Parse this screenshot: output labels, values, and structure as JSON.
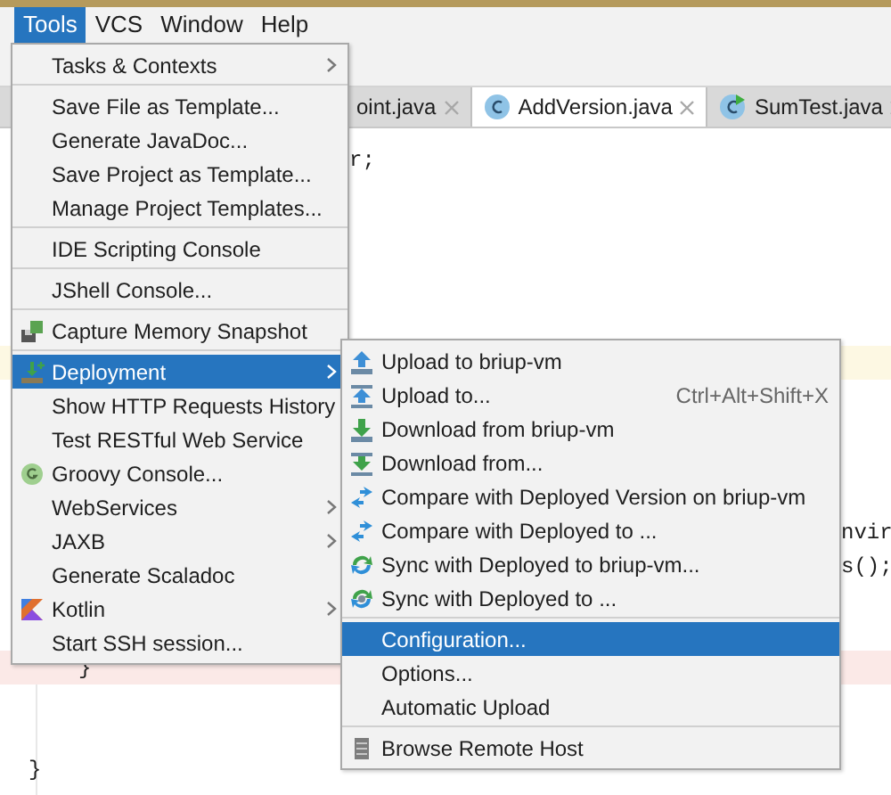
{
  "menubar": [
    {
      "label": "Tools",
      "selected": true
    },
    {
      "label": "VCS",
      "selected": false
    },
    {
      "label": "Window",
      "selected": false
    },
    {
      "label": "Help",
      "selected": false
    }
  ],
  "tabs": [
    {
      "label": "oint.java",
      "selected": false,
      "kind": "plain"
    },
    {
      "label": "AddVersion.java",
      "selected": true,
      "kind": "class"
    },
    {
      "label": "SumTest.java",
      "selected": false,
      "kind": "test"
    }
  ],
  "editor": {
    "lines": [
      {
        "text": "r;",
        "kind": "plain"
      },
      {
        "text": "nvir",
        "kind": "right"
      },
      {
        "text": "s();",
        "kind": "right"
      },
      {
        "text": "}",
        "kind": "marked"
      },
      {
        "text": "}",
        "kind": "plain-left"
      }
    ]
  },
  "tools_menu": {
    "items": [
      {
        "kind": "item",
        "label": "Tasks & Contexts",
        "submenu": true,
        "selected": false
      },
      {
        "kind": "separator"
      },
      {
        "kind": "item",
        "label": "Save File as Template...",
        "submenu": false,
        "selected": false
      },
      {
        "kind": "item",
        "label": "Generate JavaDoc...",
        "submenu": false,
        "selected": false
      },
      {
        "kind": "item",
        "label": "Save Project as Template...",
        "submenu": false,
        "selected": false
      },
      {
        "kind": "item",
        "label": "Manage Project Templates...",
        "submenu": false,
        "selected": false
      },
      {
        "kind": "separator"
      },
      {
        "kind": "item",
        "label": "IDE Scripting Console",
        "submenu": false,
        "selected": false
      },
      {
        "kind": "separator"
      },
      {
        "kind": "item",
        "label": "JShell Console...",
        "submenu": false,
        "selected": false
      },
      {
        "kind": "separator"
      },
      {
        "kind": "item",
        "label": "Capture Memory Snapshot",
        "submenu": false,
        "selected": false
      },
      {
        "kind": "separator"
      },
      {
        "kind": "item",
        "label": "Deployment",
        "submenu": true,
        "selected": true
      },
      {
        "kind": "item",
        "label": "Show HTTP Requests History",
        "submenu": false,
        "selected": false
      },
      {
        "kind": "item",
        "label": "Test RESTful Web Service",
        "submenu": false,
        "selected": false
      },
      {
        "kind": "item",
        "label": "Groovy Console...",
        "submenu": false,
        "selected": false
      },
      {
        "kind": "item",
        "label": "WebServices",
        "submenu": true,
        "selected": false
      },
      {
        "kind": "item",
        "label": "JAXB",
        "submenu": true,
        "selected": false
      },
      {
        "kind": "item",
        "label": "Generate Scaladoc",
        "submenu": false,
        "selected": false
      },
      {
        "kind": "item",
        "label": "Kotlin",
        "submenu": true,
        "selected": false
      },
      {
        "kind": "item",
        "label": "Start SSH session...",
        "submenu": false,
        "selected": false
      }
    ]
  },
  "deployment_menu": {
    "items": [
      {
        "kind": "item",
        "label": "Upload to briup-vm",
        "selected": false
      },
      {
        "kind": "item",
        "label": "Upload to...",
        "shortcut": "Ctrl+Alt+Shift+X",
        "selected": false
      },
      {
        "kind": "item",
        "label": "Download from briup-vm",
        "selected": false
      },
      {
        "kind": "item",
        "label": "Download from...",
        "selected": false
      },
      {
        "kind": "item",
        "label": "Compare with Deployed Version on briup-vm",
        "selected": false
      },
      {
        "kind": "item",
        "label": "Compare with Deployed to ...",
        "selected": false
      },
      {
        "kind": "item",
        "label": "Sync with Deployed to briup-vm...",
        "selected": false
      },
      {
        "kind": "item",
        "label": "Sync with Deployed to ...",
        "selected": false
      },
      {
        "kind": "separator"
      },
      {
        "kind": "item",
        "label": "Configuration...",
        "selected": true
      },
      {
        "kind": "item",
        "label": "Options...",
        "selected": false
      },
      {
        "kind": "item",
        "label": "Automatic Upload",
        "selected": false
      },
      {
        "kind": "separator"
      },
      {
        "kind": "item",
        "label": "Browse Remote Host",
        "selected": false
      }
    ]
  }
}
